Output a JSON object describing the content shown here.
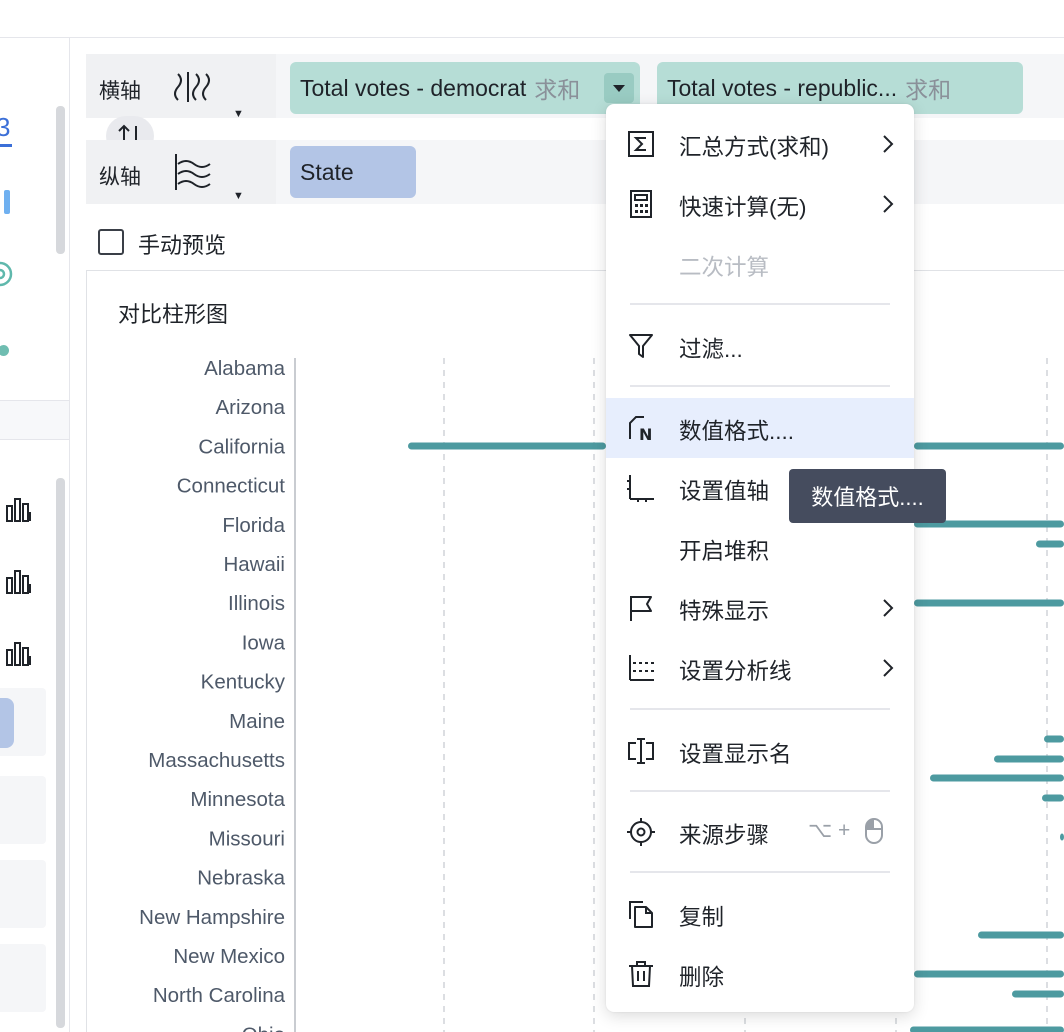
{
  "shelves": {
    "x_axis": {
      "label": "横轴"
    },
    "y_axis": {
      "label": "纵轴"
    }
  },
  "pills": {
    "democrat": {
      "field": "Total votes - democrat",
      "agg": "求和"
    },
    "republican": {
      "field": "Total votes - republic...",
      "agg": "求和"
    },
    "state": {
      "field": "State"
    }
  },
  "manual_preview": {
    "label": "手动预览"
  },
  "chart": {
    "title": "对比柱形图"
  },
  "chart_data": {
    "type": "bar",
    "orientation": "horizontal",
    "categories": [
      "Alabama",
      "Arizona",
      "California",
      "Connecticut",
      "Florida",
      "Hawaii",
      "Illinois",
      "Iowa",
      "Kentucky",
      "Maine",
      "Massachusetts",
      "Minnesota",
      "Missouri",
      "Nebraska",
      "New Hampshire",
      "New Mexico",
      "North Carolina",
      "Ohio"
    ],
    "colors": {
      "bar": "#4d9aa0",
      "grid": "#d0d3d8"
    }
  },
  "context_menu": {
    "items": [
      {
        "id": "aggregation",
        "label": "汇总方式(求和)"
      },
      {
        "id": "quick-calc",
        "label": "快速计算(无)"
      },
      {
        "id": "secondary-calc",
        "label": "二次计算"
      },
      {
        "id": "filter",
        "label": "过滤..."
      },
      {
        "id": "number-format",
        "label": "数值格式...."
      },
      {
        "id": "value-axis",
        "label": "设置值轴"
      },
      {
        "id": "stack",
        "label": "开启堆积"
      },
      {
        "id": "special-display",
        "label": "特殊显示"
      },
      {
        "id": "analysis-line",
        "label": "设置分析线"
      },
      {
        "id": "display-name",
        "label": "设置显示名"
      },
      {
        "id": "source-step",
        "label": "来源步骤",
        "shortcut": "⌥ + "
      },
      {
        "id": "copy",
        "label": "复制"
      },
      {
        "id": "delete",
        "label": "删除"
      }
    ]
  },
  "tooltip": {
    "text": "数值格式...."
  },
  "sidebar": {
    "partial_text": "3"
  }
}
